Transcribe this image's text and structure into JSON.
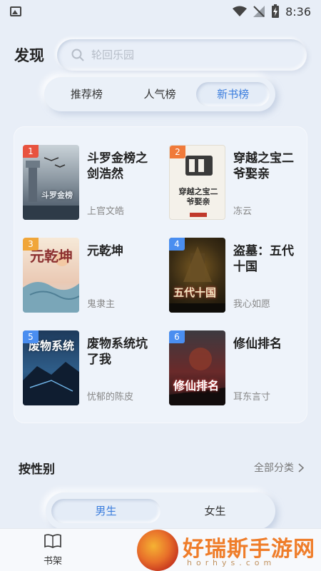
{
  "status_bar": {
    "time": "8:36"
  },
  "header": {
    "title": "发现",
    "search_placeholder": "轮回乐园"
  },
  "tabs": [
    {
      "label": "推荐榜",
      "active": false
    },
    {
      "label": "人气榜",
      "active": false
    },
    {
      "label": "新书榜",
      "active": true
    }
  ],
  "books": [
    {
      "rank": "1",
      "rank_color": "#e8533f",
      "title": "斗罗金榜之剑浩然",
      "author": "上官文皓",
      "cover_text": "斗罗金榜"
    },
    {
      "rank": "2",
      "rank_color": "#f07a3a",
      "title": "穿越之宝二爷娶亲",
      "author": "冻云",
      "cover_text": "穿越之宝二爷娶亲"
    },
    {
      "rank": "3",
      "rank_color": "#f0a63a",
      "title": "元乾坤",
      "author": "鬼隶主",
      "cover_text": "元乾坤"
    },
    {
      "rank": "4",
      "rank_color": "#4a8ef0",
      "title": "盗墓：五代十国",
      "author": "我心如愿",
      "cover_text": "五代十国"
    },
    {
      "rank": "5",
      "rank_color": "#4a8ef0",
      "title": "废物系统坑了我",
      "author": "忧郁的陈皮",
      "cover_text": "废物系统"
    },
    {
      "rank": "6",
      "rank_color": "#4a8ef0",
      "title": "修仙排名",
      "author": "耳东言寸",
      "cover_text": "修仙排名"
    }
  ],
  "gender_section": {
    "title": "按性别",
    "more_label": "全部分类",
    "tabs": [
      {
        "label": "男生",
        "active": true
      },
      {
        "label": "女生",
        "active": false
      }
    ]
  },
  "bottom_nav": {
    "bookshelf_label": "书架"
  },
  "watermark": {
    "text": "好瑞斯手游网",
    "sub": "horhys.com"
  },
  "colors": {
    "accent": "#3b7ddd",
    "background": "#e8eef7"
  }
}
